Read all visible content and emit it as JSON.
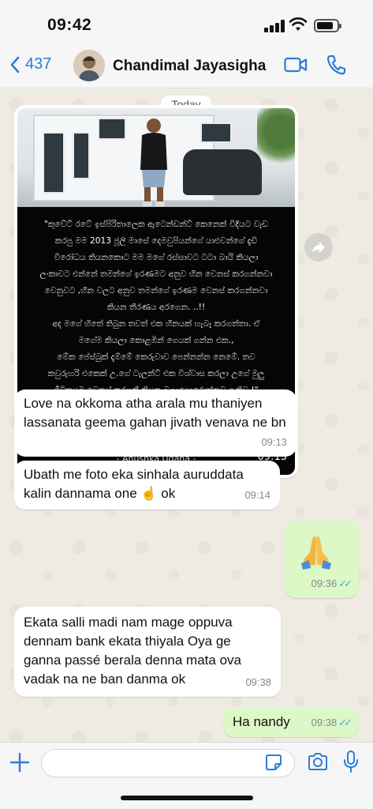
{
  "status": {
    "time": "09:42"
  },
  "header": {
    "back_count": "437",
    "contact_name": "Chandimal Jayasigha"
  },
  "chat": {
    "date_label": "Today",
    "image_message": {
      "lines": [
        "\"කුවේට් රටේ ඉස්පිරිතාලෙක ඇටෙන්ඩන්ට් කෙනෙක් විදියට වැඩ",
        "කරපු මම 2013 ජූලි මාසේ දෙමවුපියන්ගේ යාළුවන්ගේ දැඩි",
        "විරෝධය තියනකොට මම මගේ රස්සාවට ටටා බායි කියලා",
        "ලංකාවට එන්නේ තමන්ගේ ඉරණමට අනුව හීන වෙනස් කරගන්නවා",
        "වෙනුවට ,හීන වලට අනුව තමන්ගේ ඉරණම වෙනස් කරගන්නවා",
        "කියන තීරණය අරගෙන. ..!!",
        "අද මගේ හිතේ තිබුන තවත් එක හීනයක් හැබෑ කරගත්තා. ඒ",
        "මගේම කියලා කොළඹින් ගෙයක් ගන්න එක.,",
        "මේක පේස්බුක් දැම්මේ කෙරුවාව පෙන්නන්න නෙමේ. තව",
        "කවුරුහරි එකෙක් උ.ගේ ටැලන්ට් එක විශ්වාස කරලා උගේ මුලු",
        "ජීවිතයම වෙනස් කරගනී කියන බලාපොරොත්තුව ඇතිව.!\""
      ],
      "signature": "- Anushka Udana -",
      "time": "09:13"
    },
    "messages": [
      {
        "text": "Love na okkoma atha arala mu thaniyen lassanata geema gahan jivath venava ne bn",
        "time": "09:13"
      },
      {
        "text": "Ubath me foto eka sinhala auruddata kalin dannama one ☝️ ok",
        "time": "09:14"
      },
      {
        "text": "",
        "time": "09:36",
        "ticks": "✓✓"
      },
      {
        "text": "Ekata salli madi nam mage oppuva dennam bank ekata thiyala Oya ge ganna passé berala denna mata ova vadak na ne ban danma ok",
        "time": "09:38"
      },
      {
        "text": "Ha nandy",
        "time": "09:38",
        "ticks": "✓✓"
      }
    ]
  },
  "input": {
    "placeholder": "",
    "value": ""
  },
  "icons": {
    "back": "chevron-left-icon",
    "video": "video-camera-icon",
    "call": "phone-icon",
    "forward": "forward-icon",
    "plus": "plus-icon",
    "sticker": "sticker-icon",
    "camera": "camera-icon",
    "mic": "microphone-icon",
    "emoji": "folded-hands-emoji"
  },
  "colors": {
    "accent": "#2f7bd8",
    "outgoing_bubble": "#dcf8c6",
    "incoming_bubble": "#ffffff",
    "chat_bg": "#efeae2",
    "read_ticks": "#4fa3e3"
  }
}
